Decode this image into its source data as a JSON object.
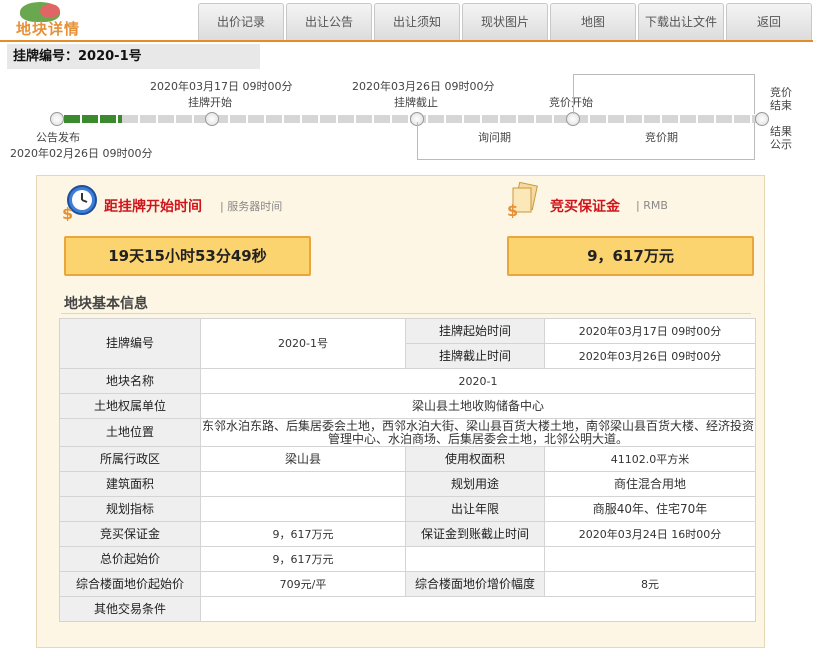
{
  "header": {
    "logo_text": "地块详情",
    "nav": [
      "出价记录",
      "出让公告",
      "出让须知",
      "现状图片",
      "地图",
      "下载出让文件",
      "返回"
    ]
  },
  "code_bar": "挂牌编号：2020-1号",
  "timeline": {
    "start_date": "2020年03月17日 09时00分",
    "start_label": "挂牌开始",
    "end_date": "2020年03月26日 09时00分",
    "end_label": "挂牌截止",
    "bid_start_label": "竞价开始",
    "bid_end_label": "竞价结束",
    "result_label": "结果公示",
    "inquiry_label": "询问期",
    "bidding_label": "竞价期",
    "announce_label": "公告发布",
    "announce_date": "2020年02月26日 09时00分"
  },
  "countdown": {
    "title": "距挂牌开始时间",
    "sub": "| 服务器时间",
    "value": "19天15小时53分49秒"
  },
  "deposit": {
    "title": "竞买保证金",
    "sub": "| RMB",
    "value": "9，617万元"
  },
  "info": {
    "title": "地块基本信息",
    "code_label": "挂牌编号",
    "code_value": "2020-1号",
    "start_label": "挂牌起始时间",
    "start_value": "2020年03月17日 09时00分",
    "end_label": "挂牌截止时间",
    "end_value": "2020年03月26日 09时00分",
    "name_label": "地块名称",
    "name_value": "2020-1",
    "owner_label": "土地权属单位",
    "owner_value": "梁山县土地收购储备中心",
    "location_label": "土地位置",
    "location_value": "东邻水泊东路、后集居委会土地，西邻水泊大街、梁山县百货大楼土地，南邻梁山县百货大楼、经济投资管理中心、水泊商场、后集居委会土地，北邻公明大道。",
    "district_label": "所属行政区",
    "district_value": "梁山县",
    "area_label": "使用权面积",
    "area_value": "41102.0平方米",
    "build_area_label": "建筑面积",
    "build_area_value": "",
    "usage_label": "规划用途",
    "usage_value": "商住混合用地",
    "plan_label": "规划指标",
    "plan_value": "",
    "years_label": "出让年限",
    "years_value": "商服40年、住宅70年",
    "deposit_label": "竞买保证金",
    "deposit_value": "9，617万元",
    "deposit_deadline_label": "保证金到账截止时间",
    "deposit_deadline_value": "2020年03月24日 16时00分",
    "total_start_label": "总价起始价",
    "total_start_value": "9，617万元",
    "floor_price_label": "综合楼面地价起始价",
    "floor_price_value": "709元/平",
    "increment_label": "综合楼面地价增价幅度",
    "increment_value": "8元",
    "other_label": "其他交易条件",
    "other_value": ""
  },
  "colors": {
    "accent": "#e38c2a",
    "highlight_box": "#fbd36f",
    "panel_bg": "#fdf6e4",
    "title_red": "#d0161c",
    "progress_green": "#3c8a2e"
  }
}
